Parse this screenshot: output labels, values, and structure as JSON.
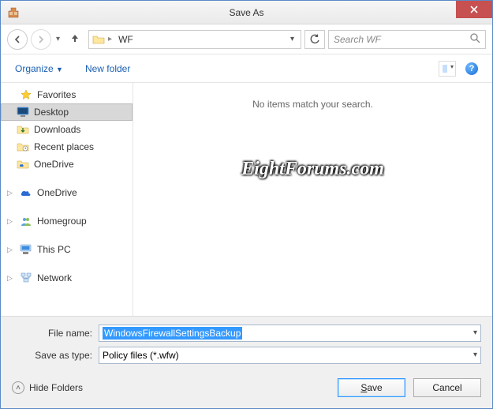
{
  "title": "Save As",
  "breadcrumb": {
    "folder": "WF"
  },
  "search": {
    "placeholder": "Search WF"
  },
  "toolbar": {
    "organize": "Organize",
    "newfolder": "New folder"
  },
  "sidebar": {
    "favorites_header": "Favorites",
    "favorites": [
      {
        "label": "Desktop"
      },
      {
        "label": "Downloads"
      },
      {
        "label": "Recent places"
      },
      {
        "label": "OneDrive"
      }
    ],
    "onedrive": "OneDrive",
    "homegroup": "Homegroup",
    "thispc": "This PC",
    "network": "Network"
  },
  "content": {
    "empty": "No items match your search."
  },
  "watermark": "EightForums.com",
  "form": {
    "filename_label": "File name:",
    "filename_value": "WindowsFirewallSettingsBackup",
    "saveastype_label": "Save as type:",
    "saveastype_value": "Policy files (*.wfw)"
  },
  "buttons": {
    "hidefolders": "Hide Folders",
    "save": "Save",
    "cancel": "Cancel"
  }
}
